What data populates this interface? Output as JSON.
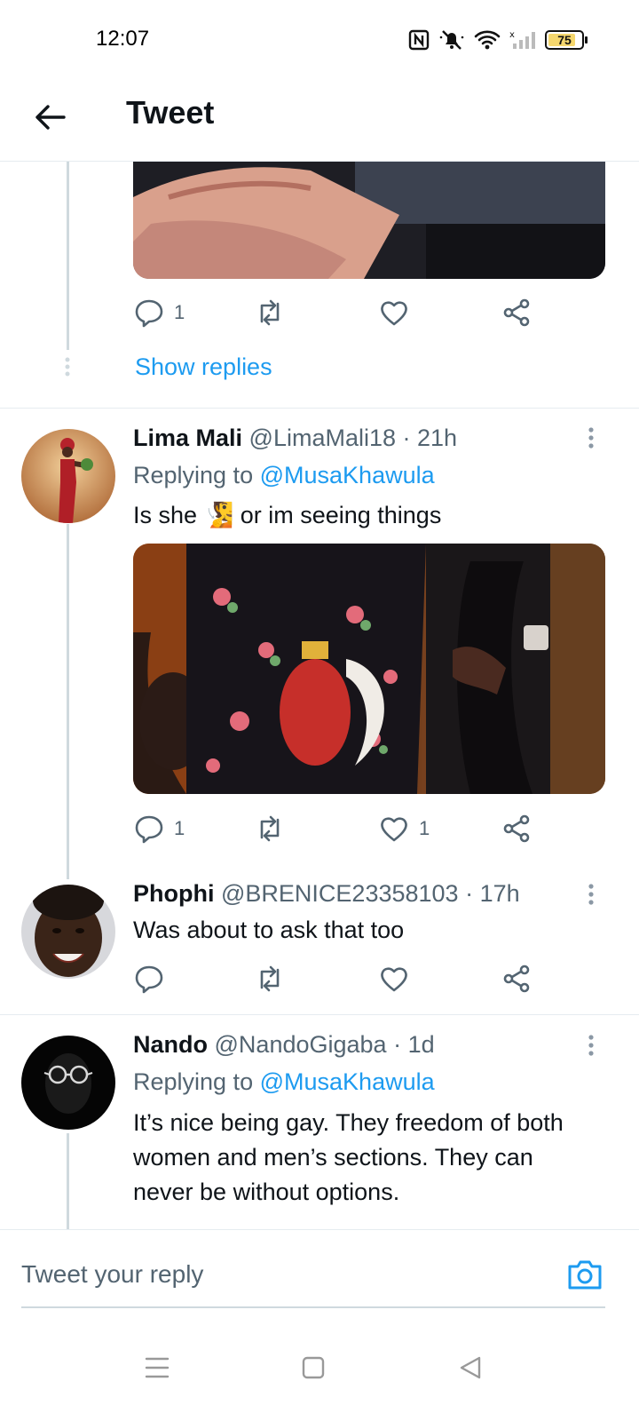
{
  "status_bar": {
    "time": "12:07",
    "battery": "75"
  },
  "header": {
    "title": "Tweet"
  },
  "tweet0": {
    "reply_count": "1",
    "show_replies": "Show replies"
  },
  "tweet1": {
    "name": "Lima Mali",
    "handle": "@LimaMali18",
    "time": "· 21h",
    "replying_prefix": "Replying to",
    "replying_to": "@MusaKhawula",
    "text_a": "Is she",
    "emoji": "🧏",
    "text_b": "or im seeing things",
    "reply_count": "1",
    "like_count": "1"
  },
  "tweet2": {
    "name": "Phophi",
    "handle": "@BRENICE23358103",
    "time": "· 17h",
    "text": "Was about to ask that too"
  },
  "tweet3": {
    "name": "Nando",
    "handle": "@NandoGigaba",
    "time": "· 1d",
    "replying_prefix": "Replying to",
    "replying_to": "@MusaKhawula",
    "text_line1": "It’s nice being gay. They freedom of both",
    "text_line2": "women and men’s sections. They can",
    "text_line3": "never be without options."
  },
  "reply_bar": {
    "placeholder": "Tweet your reply"
  },
  "colors": {
    "accent": "#1d9bf0",
    "text": "#0f1419",
    "muted": "#536471",
    "thread": "#cfd9de"
  },
  "icons": [
    "back-arrow-icon",
    "reply-icon",
    "retweet-icon",
    "like-icon",
    "share-icon",
    "more-icon",
    "camera-icon",
    "menu-icon",
    "home-square-icon",
    "back-triangle-icon"
  ]
}
